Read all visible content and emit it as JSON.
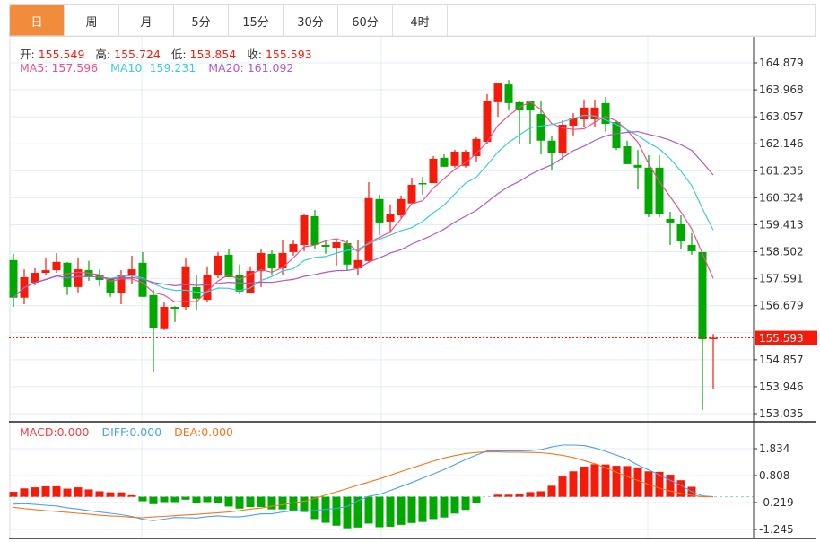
{
  "tabs": [
    {
      "label": "日",
      "active": true
    },
    {
      "label": "周"
    },
    {
      "label": "月"
    },
    {
      "label": "5分"
    },
    {
      "label": "15分"
    },
    {
      "label": "30分"
    },
    {
      "label": "60分"
    },
    {
      "label": "4时"
    }
  ],
  "ohlc_header": {
    "open_label": "开:",
    "open": "155.549",
    "high_label": "高:",
    "high": "155.724",
    "low_label": "低:",
    "low": "153.854",
    "close_label": "收:",
    "close": "155.593"
  },
  "ma_header": {
    "ma5": "MA5: 157.596",
    "ma10": "MA10: 159.231",
    "ma20": "MA20: 161.092"
  },
  "macd_header": {
    "macd": "MACD:0.000",
    "diff": "DIFF:0.000",
    "dea": "DEA:0.000"
  },
  "colors": {
    "up": "#f41b0b",
    "down": "#00a800",
    "ma5": "#f0508a",
    "ma10": "#3ec9dd",
    "ma20": "#b058c8",
    "diff": "#4aa0f0",
    "dea": "#f07820",
    "active_tab": "#f08c3c"
  },
  "chart_data": [
    {
      "type": "candlestick",
      "ylim": [
        153.035,
        164.879
      ],
      "y_ticks": [
        "164.879",
        "163.968",
        "163.057",
        "162.146",
        "161.235",
        "160.324",
        "159.413",
        "158.502",
        "157.591",
        "156.679",
        "154.857",
        "153.946",
        "153.035"
      ],
      "last_price_label": "155.593",
      "ma_periods": [
        5,
        10,
        20
      ],
      "candles": [
        [
          158.22,
          158.43,
          156.64,
          156.95
        ],
        [
          156.95,
          157.91,
          156.73,
          157.64
        ],
        [
          157.46,
          157.94,
          157.37,
          157.79
        ],
        [
          157.79,
          158.31,
          157.7,
          157.88
        ],
        [
          157.88,
          158.46,
          157.79,
          158.16
        ],
        [
          158.13,
          158.16,
          157.04,
          157.31
        ],
        [
          157.31,
          158.31,
          157.13,
          157.91
        ],
        [
          157.88,
          158.19,
          157.52,
          157.64
        ],
        [
          157.7,
          157.91,
          157.34,
          157.55
        ],
        [
          157.58,
          157.6,
          156.98,
          157.1
        ],
        [
          157.1,
          157.88,
          156.73,
          157.73
        ],
        [
          157.7,
          158.37,
          157.4,
          157.91
        ],
        [
          158.13,
          158.49,
          156.98,
          156.98
        ],
        [
          157.04,
          157.22,
          154.43,
          155.92
        ],
        [
          155.89,
          156.79,
          155.86,
          156.64
        ],
        [
          156.64,
          156.66,
          156.13,
          156.58
        ],
        [
          156.64,
          158.28,
          156.52,
          158.01
        ],
        [
          157.31,
          157.7,
          156.52,
          156.92
        ],
        [
          156.88,
          158.01,
          156.79,
          157.7
        ],
        [
          157.7,
          158.49,
          157.61,
          158.37
        ],
        [
          158.4,
          158.61,
          157.64,
          157.64
        ],
        [
          157.7,
          158.07,
          157.07,
          157.16
        ],
        [
          157.1,
          158.01,
          157.1,
          157.85
        ],
        [
          157.85,
          158.61,
          157.31,
          158.46
        ],
        [
          158.43,
          158.55,
          157.7,
          157.94
        ],
        [
          157.94,
          158.91,
          157.7,
          158.46
        ],
        [
          158.49,
          158.91,
          158.37,
          158.76
        ],
        [
          158.73,
          159.79,
          158.52,
          159.73
        ],
        [
          159.7,
          159.91,
          158.58,
          158.73
        ],
        [
          158.73,
          158.91,
          158.43,
          158.67
        ],
        [
          158.64,
          158.91,
          158.04,
          158.82
        ],
        [
          158.79,
          158.88,
          157.88,
          158.07
        ],
        [
          157.94,
          158.91,
          157.7,
          158.22
        ],
        [
          158.19,
          160.85,
          158.13,
          160.31
        ],
        [
          160.28,
          160.43,
          159.07,
          159.49
        ],
        [
          159.52,
          160.1,
          159.13,
          159.79
        ],
        [
          159.73,
          160.4,
          159.64,
          160.28
        ],
        [
          160.13,
          161.0,
          160.13,
          160.76
        ],
        [
          160.82,
          161.03,
          160.43,
          160.79
        ],
        [
          160.82,
          161.73,
          160.82,
          161.64
        ],
        [
          161.67,
          161.79,
          161.37,
          161.37
        ],
        [
          161.4,
          161.94,
          161.34,
          161.88
        ],
        [
          161.4,
          161.94,
          161.34,
          161.88
        ],
        [
          161.73,
          162.37,
          161.55,
          162.31
        ],
        [
          162.21,
          163.82,
          162.15,
          163.58
        ],
        [
          163.55,
          164.21,
          163.06,
          164.18
        ],
        [
          164.15,
          164.3,
          163.27,
          163.52
        ],
        [
          163.55,
          163.61,
          162.15,
          163.27
        ],
        [
          163.58,
          163.61,
          162.15,
          163.27
        ],
        [
          163.15,
          163.58,
          161.79,
          162.25
        ],
        [
          162.25,
          162.43,
          161.25,
          161.82
        ],
        [
          161.85,
          162.94,
          161.61,
          162.79
        ],
        [
          162.76,
          163.18,
          162.43,
          163.03
        ],
        [
          162.97,
          163.64,
          162.7,
          163.37
        ],
        [
          162.97,
          163.64,
          162.73,
          163.37
        ],
        [
          163.52,
          163.73,
          162.55,
          162.82
        ],
        [
          162.88,
          162.91,
          161.94,
          162.0
        ],
        [
          162.06,
          162.25,
          161.46,
          161.46
        ],
        [
          161.43,
          161.94,
          160.61,
          161.34
        ],
        [
          161.34,
          161.76,
          159.67,
          159.76
        ],
        [
          161.34,
          161.76,
          159.67,
          159.76
        ],
        [
          159.61,
          159.85,
          158.73,
          159.49
        ],
        [
          159.43,
          159.73,
          158.61,
          158.85
        ],
        [
          158.73,
          159.13,
          158.4,
          158.52
        ],
        [
          158.49,
          158.49,
          153.16,
          155.55
        ],
        [
          155.549,
          155.724,
          153.854,
          155.593
        ]
      ]
    },
    {
      "type": "bar+line",
      "ylim": [
        -1.245,
        1.834
      ],
      "y_ticks": [
        "1.834",
        "0.808",
        "-0.219",
        "-1.245"
      ],
      "macd": [
        0.19,
        0.32,
        0.36,
        0.4,
        0.4,
        0.31,
        0.36,
        0.28,
        0.21,
        0.17,
        0.17,
        0.06,
        -0.17,
        -0.28,
        -0.2,
        -0.2,
        -0.11,
        -0.25,
        -0.2,
        -0.22,
        -0.37,
        -0.45,
        -0.39,
        -0.39,
        -0.48,
        -0.48,
        -0.53,
        -0.58,
        -0.85,
        -0.99,
        -1.1,
        -1.2,
        -1.17,
        -1.02,
        -1.16,
        -1.14,
        -1.07,
        -1.0,
        -0.96,
        -0.85,
        -0.79,
        -0.64,
        -0.5,
        -0.25,
        0.0,
        0.08,
        0.08,
        0.12,
        0.18,
        0.21,
        0.42,
        0.77,
        0.97,
        1.15,
        1.24,
        1.23,
        1.18,
        1.17,
        1.12,
        0.97,
        0.95,
        0.84,
        0.63,
        0.38,
        0.0,
        0.0
      ],
      "diff": [
        -0.28,
        -0.26,
        -0.29,
        -0.32,
        -0.35,
        -0.42,
        -0.47,
        -0.53,
        -0.58,
        -0.63,
        -0.68,
        -0.75,
        -0.86,
        -0.91,
        -0.85,
        -0.79,
        -0.8,
        -0.81,
        -0.76,
        -0.73,
        -0.76,
        -0.77,
        -0.71,
        -0.65,
        -0.65,
        -0.58,
        -0.53,
        -0.54,
        -0.52,
        -0.48,
        -0.44,
        -0.37,
        -0.15,
        0.02,
        0.09,
        0.24,
        0.39,
        0.54,
        0.71,
        0.87,
        1.04,
        1.23,
        1.42,
        1.59,
        1.75,
        1.75,
        1.75,
        1.75,
        1.76,
        1.8,
        1.9,
        1.97,
        1.97,
        1.95,
        1.86,
        1.73,
        1.59,
        1.44,
        1.21,
        1.02,
        0.83,
        0.63,
        0.43,
        0.2,
        0.03,
        0.0
      ],
      "dea": [
        -0.4,
        -0.45,
        -0.49,
        -0.53,
        -0.56,
        -0.59,
        -0.63,
        -0.66,
        -0.7,
        -0.73,
        -0.75,
        -0.78,
        -0.8,
        -0.77,
        -0.75,
        -0.72,
        -0.69,
        -0.67,
        -0.64,
        -0.61,
        -0.58,
        -0.53,
        -0.47,
        -0.43,
        -0.36,
        -0.3,
        -0.23,
        -0.17,
        -0.06,
        0.07,
        0.19,
        0.31,
        0.44,
        0.56,
        0.68,
        0.82,
        0.96,
        1.1,
        1.23,
        1.36,
        1.48,
        1.57,
        1.65,
        1.69,
        1.71,
        1.71,
        1.7,
        1.7,
        1.69,
        1.68,
        1.64,
        1.58,
        1.5,
        1.38,
        1.26,
        1.1,
        0.94,
        0.77,
        0.62,
        0.47,
        0.33,
        0.22,
        0.13,
        0.06,
        0.0,
        0.0
      ]
    }
  ]
}
